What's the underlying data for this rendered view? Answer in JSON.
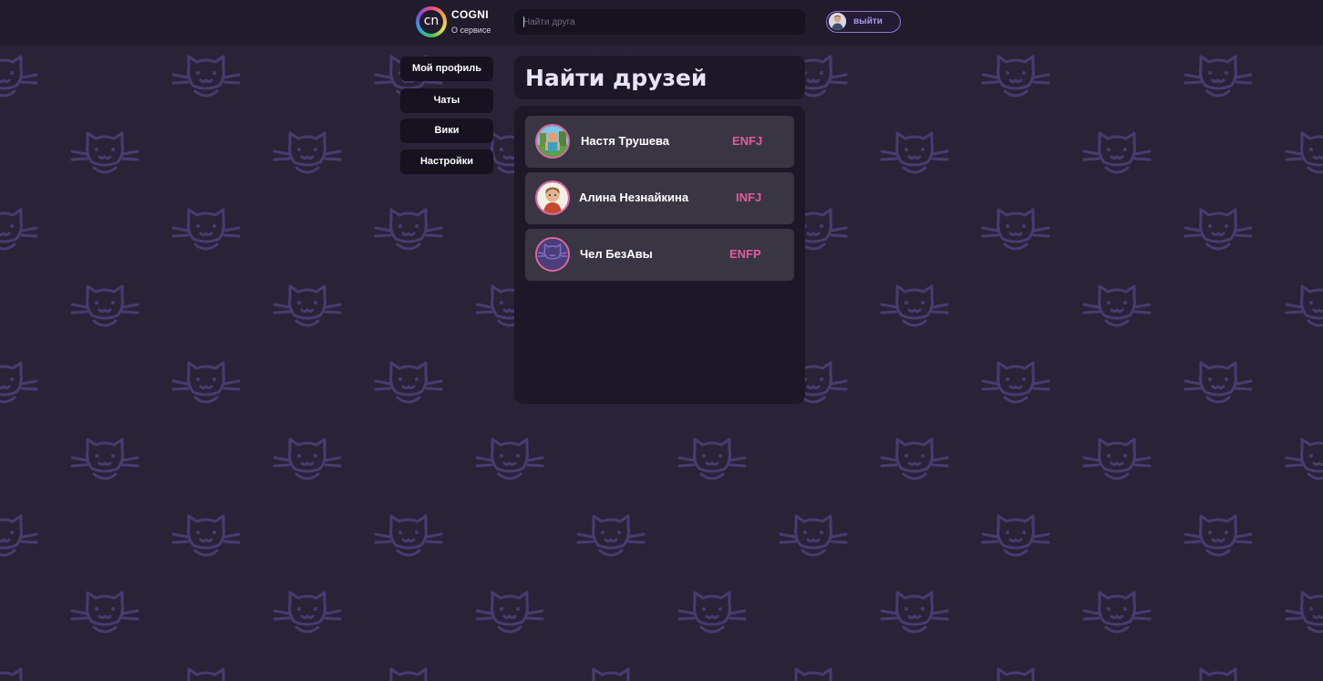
{
  "header": {
    "logo_text": "cn",
    "brand": "COGNI",
    "about_link": "О сервисе",
    "search_placeholder": "Найти друга",
    "logout_label": "выйти"
  },
  "sidebar": {
    "items": [
      {
        "label": "Мой профиль"
      },
      {
        "label": "Чаты"
      },
      {
        "label": "Вики"
      },
      {
        "label": "Настройки"
      }
    ]
  },
  "main": {
    "title": "Найти друзей",
    "friends": [
      {
        "name": "Настя Трушева",
        "type": "ENFJ"
      },
      {
        "name": "Алина Незнайкина",
        "type": "INFJ"
      },
      {
        "name": "Чел БезАвы",
        "type": "ENFP"
      }
    ]
  },
  "colors": {
    "background": "#2a2338",
    "pattern": "#463c70",
    "accent_type": "#e05c9f",
    "logout_border": "#8f78d4"
  }
}
